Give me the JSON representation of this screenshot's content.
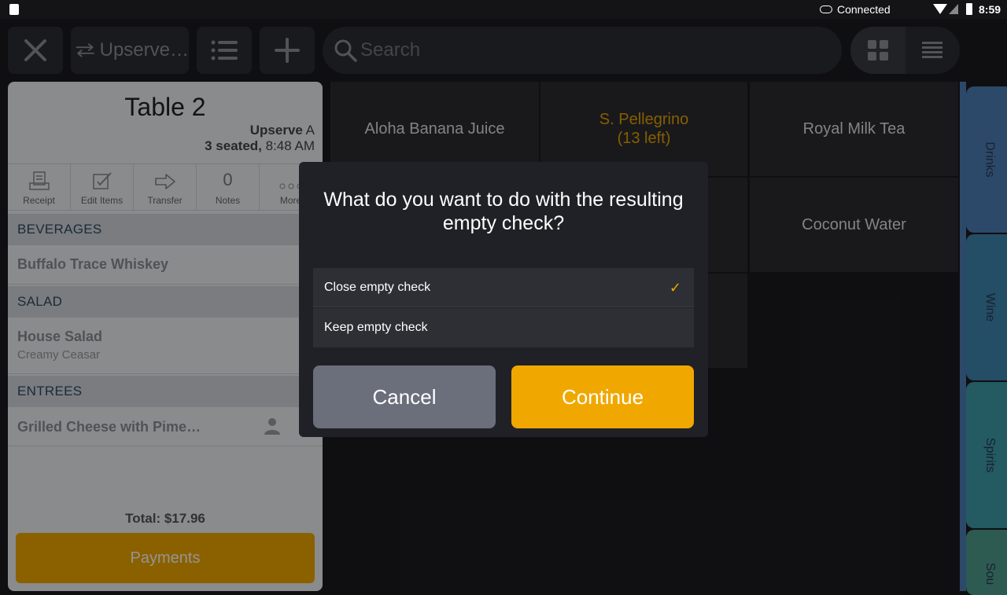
{
  "statusbar": {
    "connection": "Connected",
    "time": "8:59"
  },
  "toolbar": {
    "server_label": "Upserve…",
    "search_placeholder": "Search"
  },
  "check": {
    "table": "Table 2",
    "server_bold": "Upserve",
    "server_suffix": " A",
    "seated_bold": "3 seated,",
    "seated_time": " 8:48 AM",
    "actions": [
      {
        "label": "Receipt"
      },
      {
        "label": "Edit Items"
      },
      {
        "label": "Transfer"
      },
      {
        "label": "Notes",
        "count": "0"
      },
      {
        "label": "More"
      }
    ],
    "sections": [
      {
        "title": "BEVERAGES",
        "items": [
          {
            "name": "Buffalo Trace Whiskey"
          }
        ]
      },
      {
        "title": "SALAD",
        "items": [
          {
            "name": "House Salad",
            "modifier": "Creamy Ceasar"
          }
        ]
      },
      {
        "title": "ENTREES",
        "items": [
          {
            "name": "Grilled Cheese with Pime…"
          }
        ]
      }
    ],
    "total": "Total: $17.96",
    "payments_label": "Payments"
  },
  "menu_tiles": [
    {
      "name": "Aloha Banana Juice"
    },
    {
      "name": "S. Pellegrino",
      "note": "(13 left)"
    },
    {
      "name": "Royal Milk Tea"
    },
    {
      "name": "Coconut Water"
    }
  ],
  "category_tabs": [
    {
      "label": "Drinks",
      "color": "#4f7fb5"
    },
    {
      "label": "Wine",
      "color": "#3e86b0"
    },
    {
      "label": "Spirits",
      "color": "#3f9ca8"
    },
    {
      "label": "Sou",
      "color": "#4f9e8c"
    }
  ],
  "dialog": {
    "question": "What do you want to do with the resulting empty check?",
    "options": [
      {
        "label": "Close empty check",
        "selected": true
      },
      {
        "label": "Keep empty check",
        "selected": false
      }
    ],
    "cancel_label": "Cancel",
    "continue_label": "Continue"
  },
  "colors": {
    "accent": "#f0a800",
    "cancel": "#6b6e7b"
  }
}
